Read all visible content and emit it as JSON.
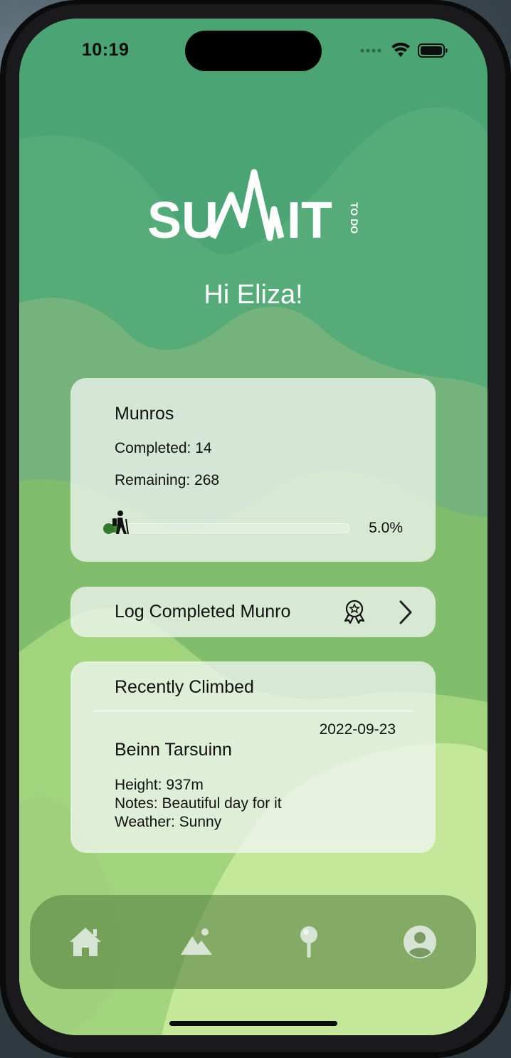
{
  "status_bar": {
    "time": "10:19"
  },
  "app": {
    "logo_text": "SUMMIT",
    "logo_subtext": "TO DO",
    "greeting": "Hi Eliza!"
  },
  "munros_card": {
    "title": "Munros",
    "completed_label": "Completed: 14",
    "remaining_label": "Remaining: 268",
    "progress_fraction": 0.05,
    "progress_text": "5.0%"
  },
  "log_card": {
    "label": "Log Completed Munro",
    "icons": [
      "award-icon",
      "chevron-right-icon"
    ]
  },
  "recent_card": {
    "title": "Recently Climbed",
    "date": "2022-09-23",
    "mountain": "Beinn Tarsuinn",
    "height": "Height: 937m",
    "notes": "Notes: Beautiful day for it",
    "weather": "Weather: Sunny"
  },
  "tab_bar": {
    "tabs": [
      "home-icon",
      "mountain-icon",
      "map-pin-icon",
      "profile-icon"
    ]
  },
  "colors": {
    "top_green": "#4aa473",
    "bottom_green": "#c3e89a",
    "progress_green": "#3c8a2f"
  }
}
